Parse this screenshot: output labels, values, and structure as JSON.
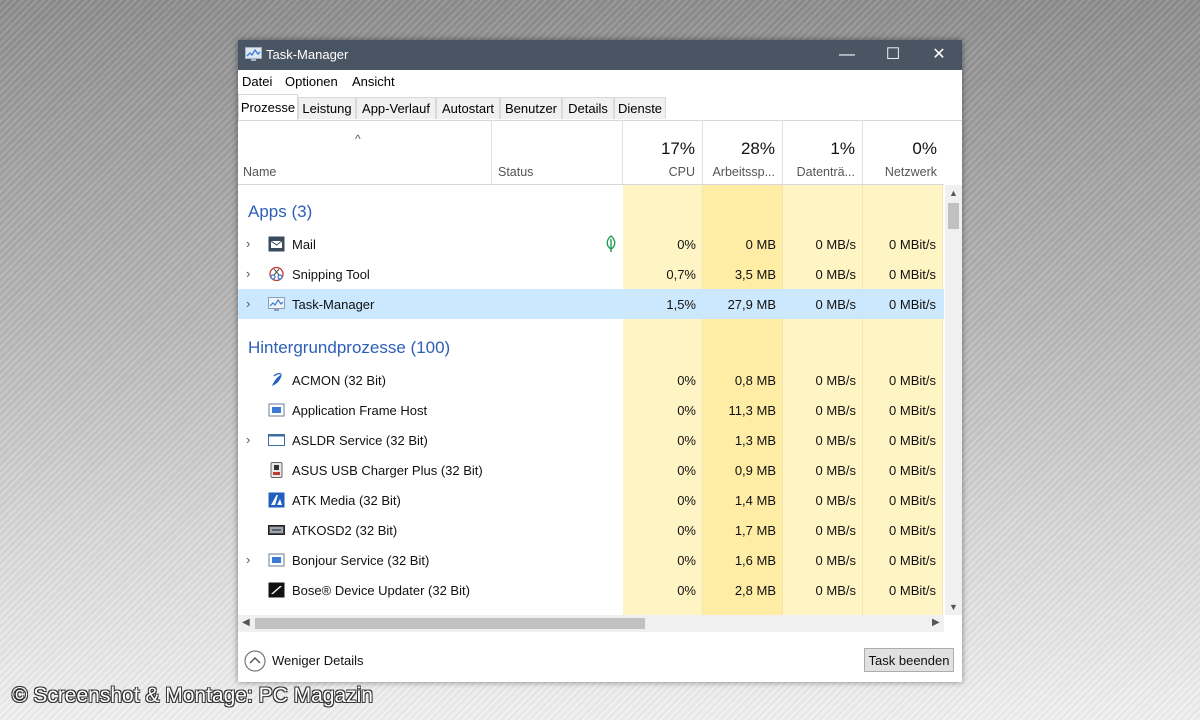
{
  "window": {
    "title": "Task-Manager",
    "controls": [
      "—",
      "☐",
      "✕"
    ]
  },
  "menu": [
    "Datei",
    "Optionen",
    "Ansicht"
  ],
  "tabs": [
    "Prozesse",
    "Leistung",
    "App-Verlauf",
    "Autostart",
    "Benutzer",
    "Details",
    "Dienste"
  ],
  "active_tab": "Prozesse",
  "columns": {
    "name": "Name",
    "status": "Status",
    "cpu": {
      "percent": "17%",
      "label": "CPU"
    },
    "memory": {
      "percent": "28%",
      "label": "Arbeitssp..."
    },
    "disk": {
      "percent": "1%",
      "label": "Datenträ..."
    },
    "network": {
      "percent": "0%",
      "label": "Netzwerk"
    }
  },
  "groups": {
    "apps": {
      "label": "Apps (3)",
      "rows": [
        {
          "name": "Mail",
          "icon": "mail-icon",
          "expandable": true,
          "status_icon": "leaf-icon",
          "cpu": "0%",
          "mem": "0 MB",
          "disk": "0 MB/s",
          "net": "0 MBit/s"
        },
        {
          "name": "Snipping Tool",
          "icon": "snipping-tool-icon",
          "expandable": true,
          "cpu": "0,7%",
          "mem": "3,5 MB",
          "disk": "0 MB/s",
          "net": "0 MBit/s"
        },
        {
          "name": "Task-Manager",
          "icon": "task-manager-icon",
          "expandable": true,
          "selected": true,
          "cpu": "1,5%",
          "mem": "27,9 MB",
          "disk": "0 MB/s",
          "net": "0 MBit/s"
        }
      ]
    },
    "background": {
      "label": "Hintergrundprozesse (100)",
      "rows": [
        {
          "name": "ACMON (32 Bit)",
          "icon": "acmon-icon",
          "expandable": false,
          "cpu": "0%",
          "mem": "0,8 MB",
          "disk": "0 MB/s",
          "net": "0 MBit/s"
        },
        {
          "name": "Application Frame Host",
          "icon": "app-frame-icon",
          "expandable": false,
          "cpu": "0%",
          "mem": "11,3 MB",
          "disk": "0 MB/s",
          "net": "0 MBit/s"
        },
        {
          "name": "ASLDR Service (32 Bit)",
          "icon": "window-icon",
          "expandable": true,
          "cpu": "0%",
          "mem": "1,3 MB",
          "disk": "0 MB/s",
          "net": "0 MBit/s"
        },
        {
          "name": "ASUS USB Charger Plus (32 Bit)",
          "icon": "usb-charger-icon",
          "expandable": false,
          "cpu": "0%",
          "mem": "0,9 MB",
          "disk": "0 MB/s",
          "net": "0 MBit/s"
        },
        {
          "name": "ATK Media (32 Bit)",
          "icon": "atk-media-icon",
          "expandable": false,
          "cpu": "0%",
          "mem": "1,4 MB",
          "disk": "0 MB/s",
          "net": "0 MBit/s"
        },
        {
          "name": "ATKOSD2 (32 Bit)",
          "icon": "atkosd-icon",
          "expandable": false,
          "cpu": "0%",
          "mem": "1,7 MB",
          "disk": "0 MB/s",
          "net": "0 MBit/s"
        },
        {
          "name": "Bonjour Service (32 Bit)",
          "icon": "service-icon",
          "expandable": true,
          "cpu": "0%",
          "mem": "1,6 MB",
          "disk": "0 MB/s",
          "net": "0 MBit/s"
        },
        {
          "name": "Bose® Device Updater (32 Bit)",
          "icon": "bose-icon",
          "expandable": false,
          "cpu": "0%",
          "mem": "2,8 MB",
          "disk": "0 MB/s",
          "net": "0 MBit/s"
        }
      ]
    }
  },
  "footer": {
    "less_details": "Weniger Details",
    "end_task": "Task beenden"
  },
  "credit": "© Screenshot & Montage: PC Magazin",
  "colors": {
    "titlebar": "#4a5563",
    "group_text": "#2b5fb8",
    "cpu_bg": "#fff4c4",
    "mem_bg": "#ffeca5",
    "selected_row": "#cce8ff"
  }
}
